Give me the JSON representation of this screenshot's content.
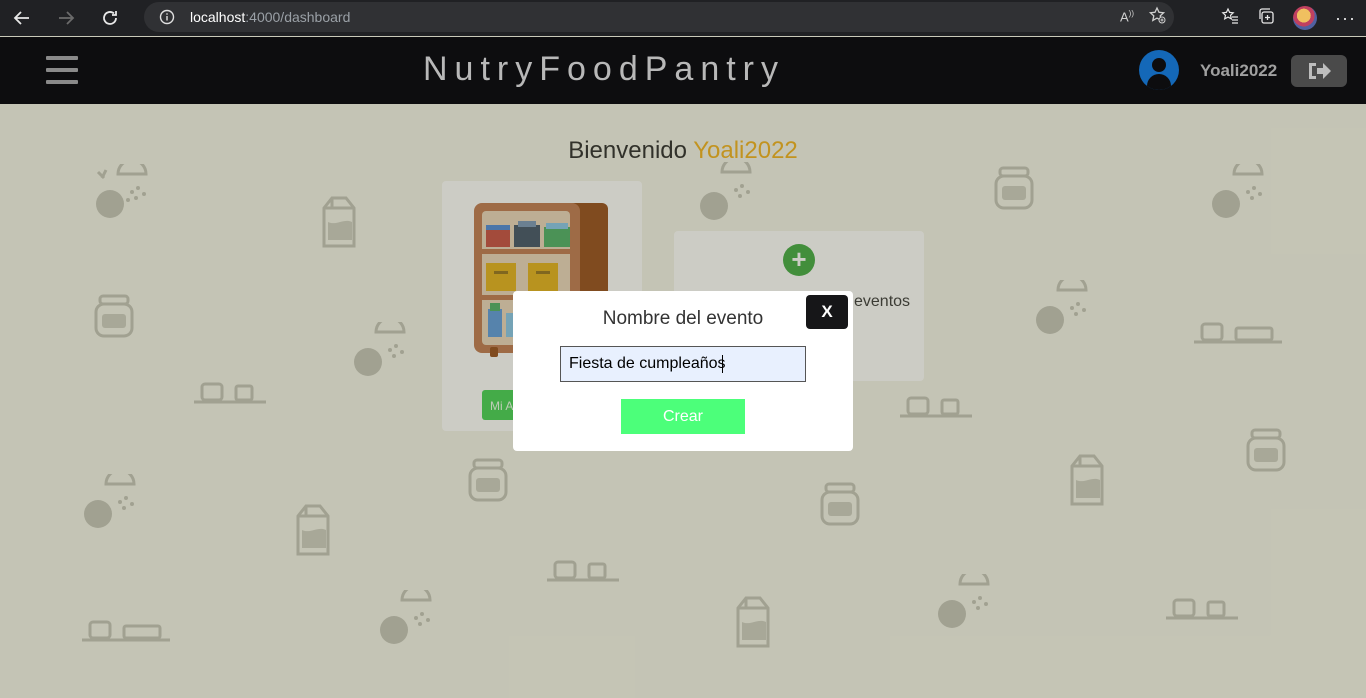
{
  "browser": {
    "url_host": "localhost",
    "url_path": ":4000/dashboard",
    "icons": [
      "back-icon",
      "forward-icon",
      "refresh-icon",
      "info-icon",
      "read-aloud-icon",
      "add-favorite-icon",
      "favorites-icon",
      "collections-icon",
      "profile-icon",
      "more-icon"
    ]
  },
  "header": {
    "brand": "NutryFoodPantry",
    "username": "Yoali2022",
    "icons": [
      "menu-icon",
      "user-avatar-icon",
      "logout-icon"
    ]
  },
  "main": {
    "welcome_prefix": "Bienvenido",
    "welcome_user": "Yoali2022",
    "pantry_button_label": "Mi A",
    "events_label": "eventos",
    "colors": {
      "accent": "#f0a800",
      "green": "#2ecc40",
      "header_bg": "#0d0d0f"
    }
  },
  "modal": {
    "title": "Nombre del evento",
    "close_label": "X",
    "input_value": "Fiesta de cumpleaños",
    "create_label": "Crear"
  }
}
